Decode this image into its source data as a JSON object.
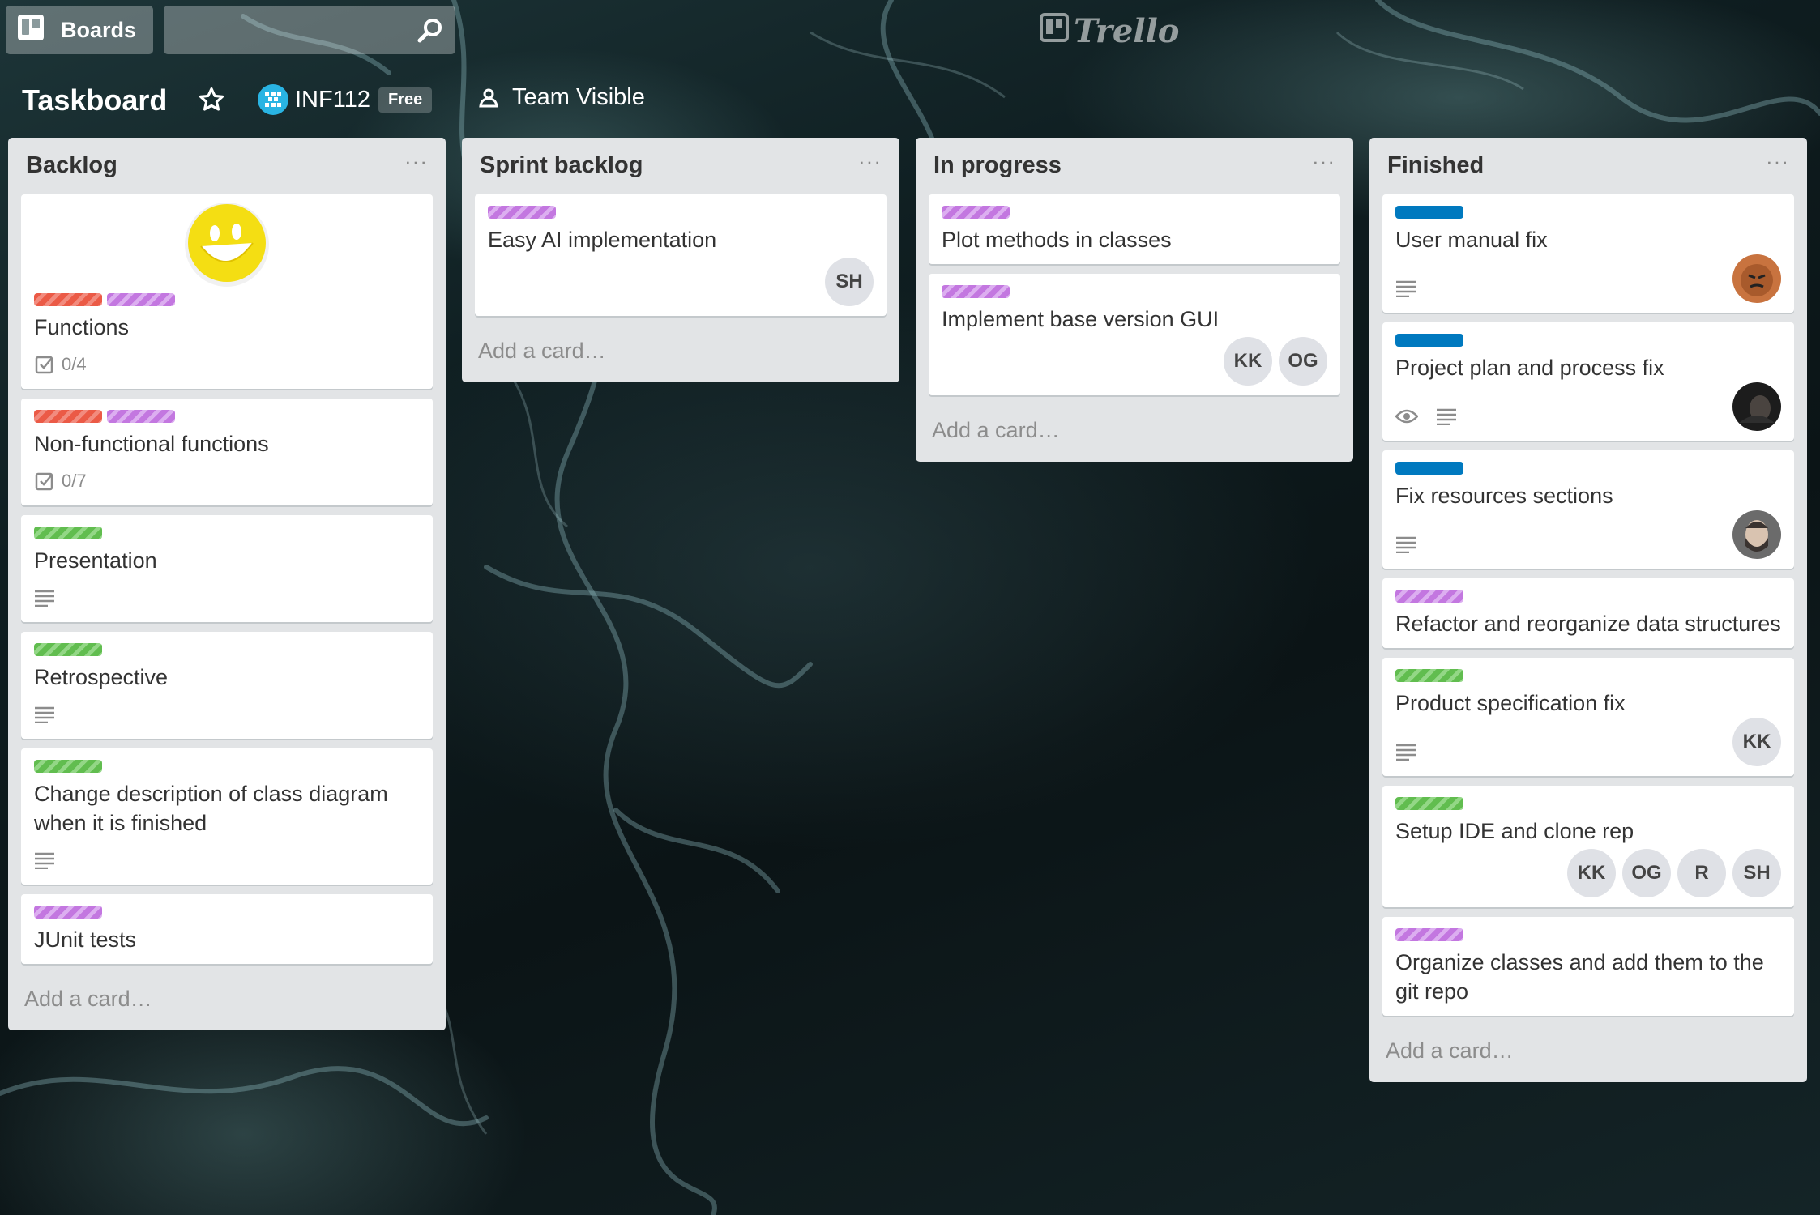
{
  "header": {
    "boards_label": "Boards",
    "search_placeholder": "",
    "logo_text": "Trello"
  },
  "board": {
    "title": "Taskboard",
    "team_name": "INF112",
    "team_plan": "Free",
    "visibility": "Team Visible"
  },
  "add_card_label": "Add a card…",
  "lists": [
    {
      "title": "Backlog",
      "menu": "···",
      "cards": [
        {
          "title": "Functions",
          "checklist": "0/4"
        },
        {
          "title": "Non-functional functions",
          "checklist": "0/7"
        },
        {
          "title": "Presentation"
        },
        {
          "title": "Retrospective"
        },
        {
          "title": "Change description of class diagram when it is finished"
        },
        {
          "title": "JUnit tests"
        }
      ]
    },
    {
      "title": "Sprint backlog",
      "menu": "···",
      "cards": [
        {
          "title": "Easy AI implementation",
          "members": [
            "SH"
          ]
        }
      ]
    },
    {
      "title": "In progress",
      "menu": "···",
      "cards": [
        {
          "title": "Plot methods in classes"
        },
        {
          "title": "Implement base version GUI",
          "members": [
            "KK",
            "OG"
          ]
        }
      ]
    },
    {
      "title": "Finished",
      "menu": "···",
      "cards": [
        {
          "title": "User manual fix"
        },
        {
          "title": "Project plan and process fix"
        },
        {
          "title": "Fix resources sections"
        },
        {
          "title": "Refactor and reorganize data structures"
        },
        {
          "title": "Product specification fix",
          "members": [
            "KK"
          ]
        },
        {
          "title": "Setup IDE and clone rep",
          "members": [
            "KK",
            "OG",
            "R",
            "SH"
          ]
        },
        {
          "title": "Organize classes and add them to the git repo"
        }
      ]
    }
  ],
  "colors": {
    "label_red": "#eb5a46",
    "label_purple": "#c377e0",
    "label_green": "#61bd4f",
    "label_blue": "#0079bf",
    "list_bg": "#e2e4e6"
  }
}
